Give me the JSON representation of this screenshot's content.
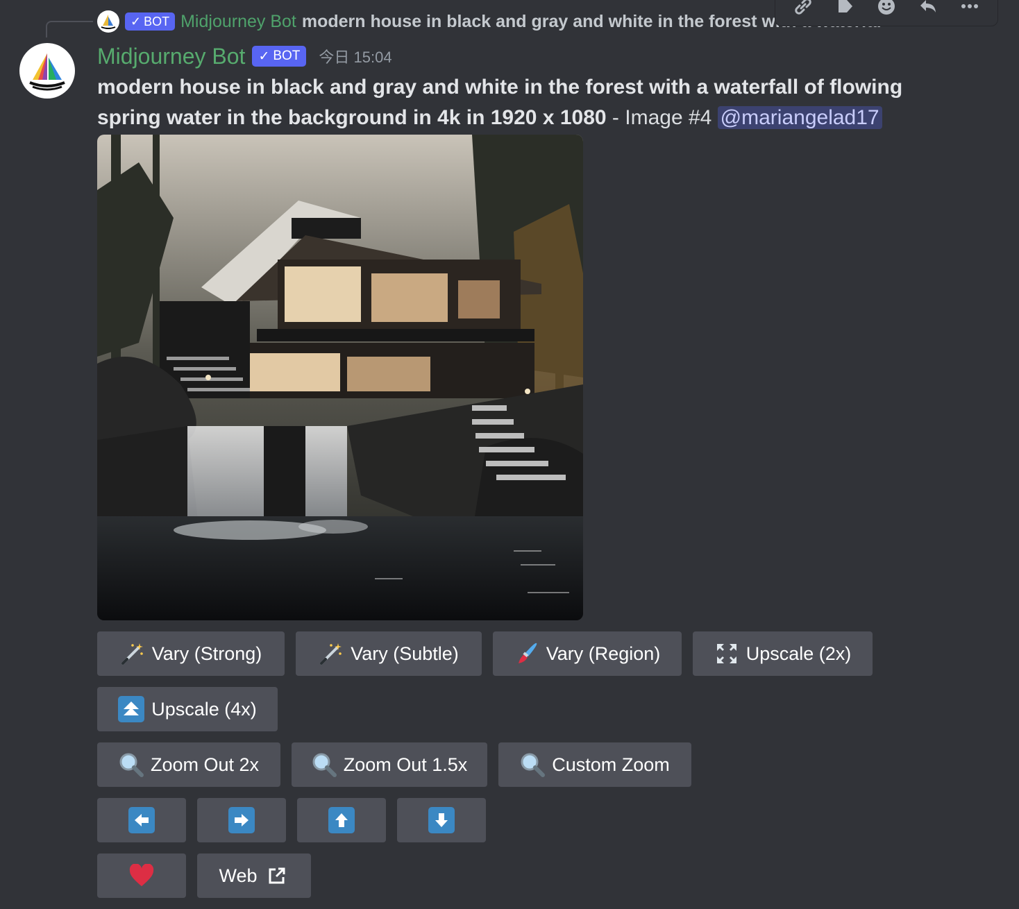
{
  "reply": {
    "bot_label": "BOT",
    "author": "Midjourney Bot",
    "text": "modern house in black and gray and white in the forest with a waterfal"
  },
  "toolbar": {
    "icons": [
      "link-icon",
      "tag-icon",
      "emoji-icon",
      "reply-icon",
      "more-icon"
    ]
  },
  "message": {
    "author": "Midjourney Bot",
    "bot_label": "BOT",
    "timestamp": "今日 15:04",
    "prompt": "modern house in black and gray and white in the forest with a waterfall of flowing spring water in the background in 4k in 1920 x 1080",
    "suffix": " - Image #4 ",
    "mention": "@mariangelad17",
    "name_color": "#57ab6e"
  },
  "buttons": {
    "vary_strong": "Vary (Strong)",
    "vary_subtle": "Vary (Subtle)",
    "vary_region": "Vary (Region)",
    "upscale_2x": "Upscale (2x)",
    "upscale_4x": "Upscale (4x)",
    "zoom_out_2x": "Zoom Out 2x",
    "zoom_out_15x": "Zoom Out 1.5x",
    "custom_zoom": "Custom Zoom",
    "web": "Web"
  },
  "colors": {
    "background": "#313338",
    "button": "#4e5058",
    "accent": "#5865f2",
    "arrow_blue": "#3b88c3",
    "heart": "#dd2e44"
  }
}
